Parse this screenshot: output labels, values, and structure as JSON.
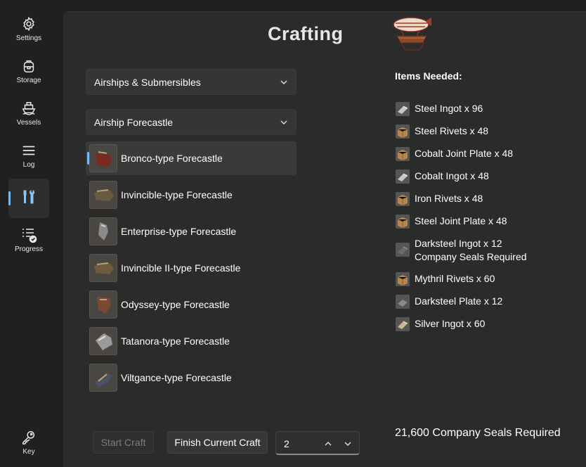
{
  "nav": {
    "items": [
      {
        "label": "Settings",
        "icon": "gear-icon"
      },
      {
        "label": "Storage",
        "icon": "backpack-icon"
      },
      {
        "label": "Vessels",
        "icon": "ship-icon"
      },
      {
        "label": "Log",
        "icon": "hamburger-lines-icon"
      },
      {
        "label": "",
        "icon": "crafting-tools-icon",
        "active": true
      },
      {
        "label": "Progress",
        "icon": "checklist-icon"
      }
    ],
    "bottom": {
      "label": "Key",
      "icon": "key-icon"
    }
  },
  "page": {
    "title": "Crafting",
    "category_select": "Airships & Submersibles",
    "part_select": "Airship Forecastle"
  },
  "parts": [
    {
      "name": "Bronco-type Forecastle",
      "selected": true,
      "color": "#7a2a20"
    },
    {
      "name": "Invincible-type Forecastle",
      "color": "#6b5a42"
    },
    {
      "name": "Enterprise-type Forecastle",
      "color": "#8a8a8a"
    },
    {
      "name": "Invincible II-type Forecastle",
      "color": "#6e5b40"
    },
    {
      "name": "Odyssey-type Forecastle",
      "color": "#7a4a34"
    },
    {
      "name": "Tatanora-type Forecastle",
      "color": "#9a9a9a"
    },
    {
      "name": "Viltgance-type Forecastle",
      "color": "#4a5266"
    }
  ],
  "items_needed": {
    "heading": "Items Needed:",
    "items": [
      {
        "text": "Steel Ingot x 96",
        "icon": "ingot-icon"
      },
      {
        "text": "Steel Rivets x 48",
        "icon": "crate-icon"
      },
      {
        "text": "Cobalt Joint Plate x 48",
        "icon": "crate-icon"
      },
      {
        "text": "Cobalt Ingot x 48",
        "icon": "ingot-icon"
      },
      {
        "text": "Iron Rivets x 48",
        "icon": "crate-icon"
      },
      {
        "text": "Steel Joint Plate x 48",
        "icon": "crate-icon"
      },
      {
        "text": "Darksteel Ingot x 12",
        "sub": "Company Seals Required",
        "icon": "ingot-icon"
      },
      {
        "text": "Mythril Rivets x 60",
        "icon": "crate-icon"
      },
      {
        "text": "Darksteel Plate x 12",
        "icon": "ingot-icon"
      },
      {
        "text": "Silver Ingot x 60",
        "icon": "ingot-icon"
      }
    ]
  },
  "total_cost": "21,600 Company Seals Required",
  "actions": {
    "start_label": "Start Craft",
    "finish_label": "Finish Current Craft",
    "quantity": "2"
  },
  "colors": {
    "accent": "#7ab8ef",
    "background": "#202020",
    "panel": "#2b2b2b"
  }
}
